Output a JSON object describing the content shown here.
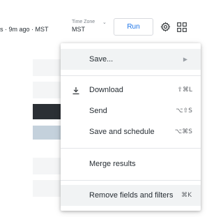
{
  "toolbar": {
    "status_text": "s · 9m ago · MST",
    "timezone_label": "Time Zone",
    "timezone_value": "MST",
    "run_label": "Run",
    "settings_icon": "gear-icon",
    "apps_icon": "grid-icon"
  },
  "menu": {
    "items": [
      {
        "label": "Save...",
        "shortcut": "",
        "icon": "",
        "has_submenu": true
      },
      {
        "label": "Download",
        "shortcut": "⇧⌘L",
        "icon": "download-icon"
      },
      {
        "label": "Send",
        "shortcut": "⌥⇧S",
        "icon": ""
      },
      {
        "label": "Save and schedule",
        "shortcut": "⌥⌘S",
        "icon": ""
      },
      {
        "label": "Merge results",
        "shortcut": "",
        "icon": ""
      },
      {
        "label": "Remove fields and filters",
        "shortcut": "⌘K",
        "icon": ""
      }
    ]
  },
  "colors": {
    "accent": "#1a73e8",
    "text": "#262d33",
    "muted": "#7a8188",
    "highlight": "#f1f3f4"
  }
}
